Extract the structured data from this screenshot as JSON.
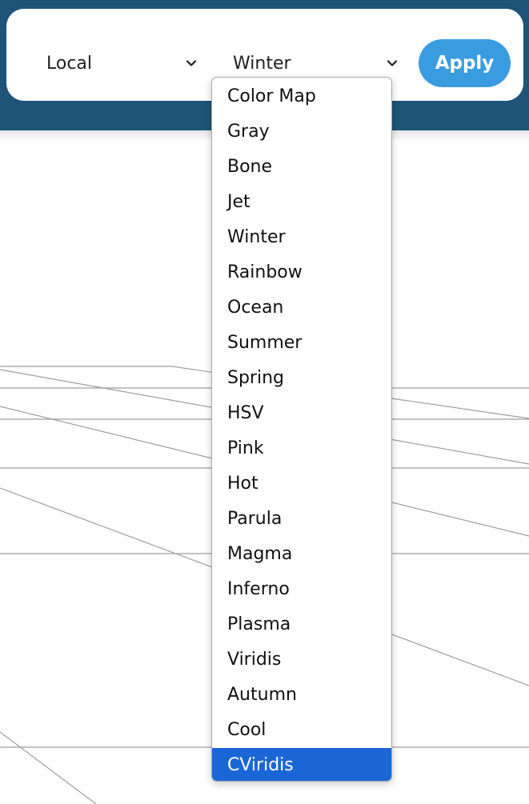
{
  "toolbar": {
    "scope_select": {
      "value": "Local"
    },
    "colormap_select": {
      "value": "Winter"
    },
    "apply_label": "Apply"
  },
  "colormap_dropdown": {
    "options": [
      "Color Map",
      "Gray",
      "Bone",
      "Jet",
      "Winter",
      "Rainbow",
      "Ocean",
      "Summer",
      "Spring",
      "HSV",
      "Pink",
      "Hot",
      "Parula",
      "Magma",
      "Inferno",
      "Plasma",
      "Viridis",
      "Autumn",
      "Cool",
      "CViridis"
    ],
    "highlighted": "CViridis"
  },
  "colors": {
    "header_band": "#1d5478",
    "apply_button": "#3a9ce0",
    "option_highlight": "#1a66d6",
    "line_stroke": "#9e9e9e"
  },
  "icons": {
    "scope_select": "chevron-down-icon",
    "colormap_select": "chevron-down-icon"
  }
}
